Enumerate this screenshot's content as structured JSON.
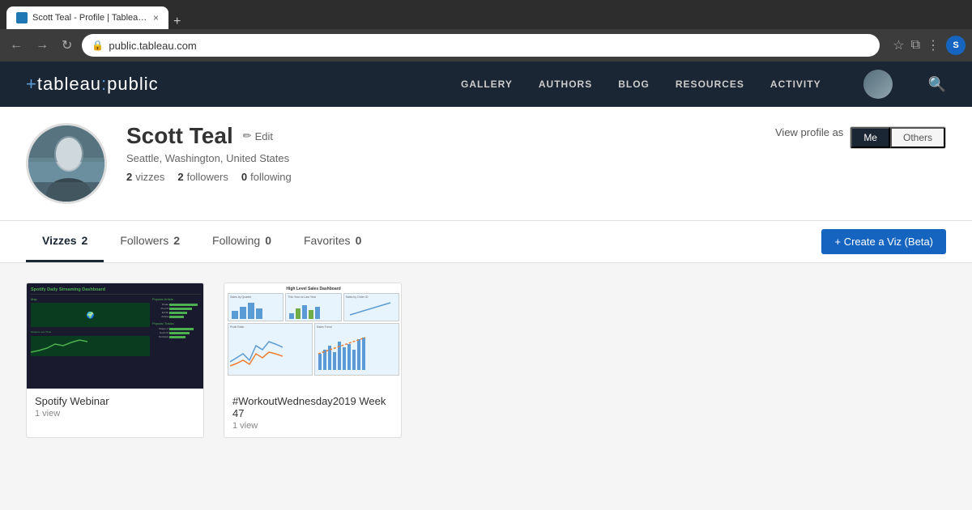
{
  "browser": {
    "tab_title": "Scott Teal - Profile | Tableau P...",
    "url": "public.tableau.com",
    "new_tab": "+"
  },
  "nav": {
    "logo": "+tableau:public",
    "links": [
      "GALLERY",
      "AUTHORS",
      "BLOG",
      "RESOURCES",
      "ACTIVITY"
    ]
  },
  "profile": {
    "name": "Scott Teal",
    "location": "Seattle, Washington, United States",
    "edit_label": "Edit",
    "stats": {
      "vizzes": {
        "num": "2",
        "label": "vizzes"
      },
      "followers": {
        "num": "2",
        "label": "followers"
      },
      "following": {
        "num": "0",
        "label": "following"
      }
    },
    "view_profile_as": "View profile as",
    "view_me": "Me",
    "view_others": "Others"
  },
  "tabs": [
    {
      "label": "Vizzes",
      "count": "2",
      "active": true
    },
    {
      "label": "Followers",
      "count": "2",
      "active": false
    },
    {
      "label": "Following",
      "count": "0",
      "active": false
    },
    {
      "label": "Favorites",
      "count": "0",
      "active": false
    }
  ],
  "create_viz_btn": "+ Create a Viz (Beta)",
  "vizzes": [
    {
      "title": "Spotify Webinar",
      "views": "1 view",
      "type": "spotify"
    },
    {
      "title": "#WorkoutWednesday2019 Week 47",
      "views": "1 view",
      "type": "workout"
    }
  ]
}
